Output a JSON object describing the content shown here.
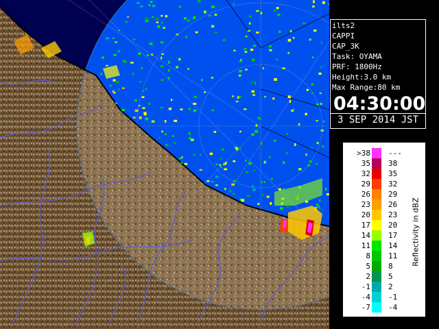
{
  "info": {
    "lines": [
      "ilts2",
      "CAPPI",
      "CAP_3K",
      "Task: OYAMA",
      "PRF: 1800Hz",
      "Height:3.0 km",
      "Max Range:80 km"
    ],
    "time": "04:30:00",
    "date": "3 SEP 2014 JST"
  },
  "legend": {
    "unit": "Reflectivity in dBZ",
    "rows": [
      {
        "lo": ">38",
        "hi": "---",
        "color": "#ff33ff"
      },
      {
        "lo": "35",
        "hi": "38",
        "color": "#b4005a"
      },
      {
        "lo": "32",
        "hi": "35",
        "color": "#e60000"
      },
      {
        "lo": "29",
        "hi": "32",
        "color": "#ff3c00"
      },
      {
        "lo": "26",
        "hi": "29",
        "color": "#ff8200"
      },
      {
        "lo": "23",
        "hi": "26",
        "color": "#ffa000"
      },
      {
        "lo": "20",
        "hi": "23",
        "color": "#ffc800"
      },
      {
        "lo": "17",
        "hi": "20",
        "color": "#ffff00"
      },
      {
        "lo": "14",
        "hi": "17",
        "color": "#96ff00"
      },
      {
        "lo": "11",
        "hi": "14",
        "color": "#00e600"
      },
      {
        "lo": "8",
        "hi": "11",
        "color": "#00c800"
      },
      {
        "lo": "5",
        "hi": "8",
        "color": "#00aa00"
      },
      {
        "lo": "2",
        "hi": "5",
        "color": "#009650"
      },
      {
        "lo": "-1",
        "hi": "2",
        "color": "#00aaaa"
      },
      {
        "lo": "-4",
        "hi": "-1",
        "color": "#00d2d2"
      },
      {
        "lo": "-7",
        "hi": "-4",
        "color": "#00ffff"
      }
    ]
  }
}
